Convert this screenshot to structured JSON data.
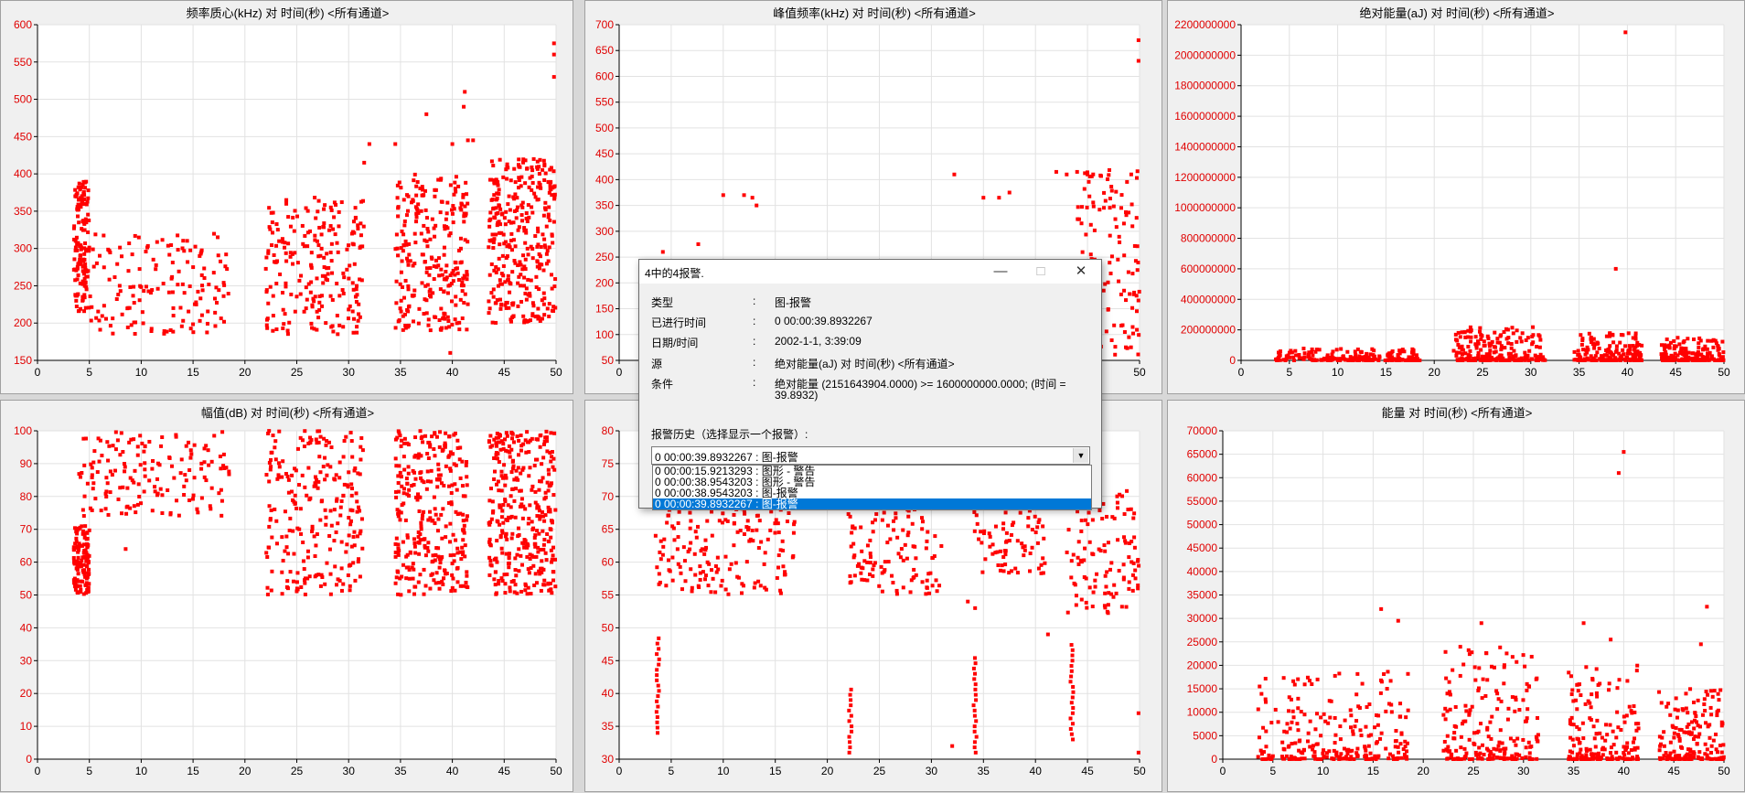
{
  "colors": {
    "point": "#ff0000",
    "axis": "#000000",
    "grid": "#e2e2e2",
    "ytick": "#e00000"
  },
  "panels": [
    {
      "title": "频率质心(kHz) 对 时间(秒) <所有通道>",
      "yticks": [
        "150",
        "200",
        "250",
        "300",
        "350",
        "400",
        "450",
        "500",
        "550",
        "600"
      ]
    },
    {
      "title": "峰值频率(kHz) 对 时间(秒) <所有通道>",
      "yticks": [
        "50",
        "100",
        "150",
        "200",
        "250",
        "300",
        "350",
        "400",
        "450",
        "500",
        "550",
        "600",
        "650",
        "700"
      ]
    },
    {
      "title": "绝对能量(aJ) 对 时间(秒) <所有通道>",
      "yticks": [
        "0",
        "200000000",
        "400000000",
        "600000000",
        "800000000",
        "1000000000",
        "1200000000",
        "1400000000",
        "1600000000",
        "1800000000",
        "2000000000",
        "2200000000"
      ]
    },
    {
      "title": "幅值(dB) 对 时间(秒) <所有通道>",
      "yticks": [
        "0",
        "10",
        "20",
        "30",
        "40",
        "50",
        "60",
        "70",
        "80",
        "90",
        "100"
      ]
    },
    {
      "title": "",
      "yticks": [
        "30",
        "35",
        "40",
        "45",
        "50",
        "55",
        "60",
        "65",
        "70",
        "75",
        "80"
      ]
    },
    {
      "title": "能量 对 时间(秒) <所有通道>",
      "yticks": [
        "0",
        "5000",
        "10000",
        "15000",
        "20000",
        "25000",
        "30000",
        "35000",
        "40000",
        "45000",
        "50000",
        "55000",
        "60000",
        "65000",
        "70000"
      ]
    }
  ],
  "xticks": [
    "0",
    "5",
    "10",
    "15",
    "20",
    "25",
    "30",
    "35",
    "40",
    "45",
    "50"
  ],
  "chart_data": [
    {
      "type": "scatter",
      "title": "频率质心(kHz) 对 时间(秒) <所有通道>",
      "xlim": [
        0,
        50
      ],
      "ylim": [
        150,
        600
      ],
      "clusters": [
        {
          "x": [
            3.5,
            5
          ],
          "y": [
            215,
            390
          ],
          "n": 140
        },
        {
          "x": [
            5,
            18.5
          ],
          "y": [
            185,
            320
          ],
          "n": 150
        },
        {
          "x": [
            22,
            31.5
          ],
          "y": [
            185,
            370
          ],
          "n": 220
        },
        {
          "x": [
            34.5,
            41.5
          ],
          "y": [
            190,
            400
          ],
          "n": 260
        },
        {
          "x": [
            43.5,
            50
          ],
          "y": [
            200,
            420
          ],
          "n": 330
        }
      ],
      "extra": [
        [
          37.5,
          480
        ],
        [
          41.2,
          510
        ],
        [
          41.1,
          490
        ],
        [
          40,
          440
        ],
        [
          41.5,
          445
        ],
        [
          42,
          445
        ],
        [
          32,
          440
        ],
        [
          31.5,
          415
        ],
        [
          34.5,
          440
        ],
        [
          39.8,
          160
        ],
        [
          49.8,
          575
        ],
        [
          49.8,
          560
        ],
        [
          49.8,
          530
        ]
      ]
    },
    {
      "type": "scatter",
      "title": "峰值频率(kHz) 对 时间(秒) <所有通道>",
      "xlim": [
        0,
        50
      ],
      "ylim": [
        50,
        700
      ],
      "extra": [
        [
          12,
          370
        ],
        [
          12.8,
          365
        ],
        [
          13.2,
          350
        ],
        [
          10,
          370
        ],
        [
          4.2,
          260
        ],
        [
          7.6,
          275
        ],
        [
          32.2,
          410
        ],
        [
          35,
          365
        ],
        [
          36.5,
          365
        ],
        [
          37.5,
          375
        ],
        [
          42,
          415
        ],
        [
          43,
          410
        ],
        [
          44,
          415
        ],
        [
          45,
          410
        ],
        [
          48.5,
          315
        ],
        [
          49.9,
          670
        ],
        [
          49.9,
          630
        ]
      ],
      "clusters": [
        {
          "x": [
            44,
            50
          ],
          "y": [
            60,
            420
          ],
          "n": 120
        }
      ]
    },
    {
      "type": "scatter",
      "title": "绝对能量(aJ) 对 时间(秒) <所有通道>",
      "xlim": [
        0,
        50
      ],
      "ylim": [
        0,
        2200000000
      ],
      "clusters": [
        {
          "x": [
            3.5,
            18.5
          ],
          "y": [
            0,
            80000000
          ],
          "n": 200
        },
        {
          "x": [
            22,
            31.5
          ],
          "y": [
            0,
            220000000
          ],
          "n": 220
        },
        {
          "x": [
            34.5,
            41.5
          ],
          "y": [
            0,
            180000000
          ],
          "n": 180
        },
        {
          "x": [
            43.5,
            50
          ],
          "y": [
            0,
            150000000
          ],
          "n": 180
        }
      ],
      "extra": [
        [
          39.8,
          2150000000
        ],
        [
          38.8,
          600000000
        ]
      ]
    },
    {
      "type": "scatter",
      "title": "幅值(dB) 对 时间(秒) <所有通道>",
      "xlim": [
        0,
        50
      ],
      "ylim": [
        0,
        100
      ],
      "clusters": [
        {
          "x": [
            3.5,
            5
          ],
          "y": [
            50,
            71
          ],
          "n": 120
        },
        {
          "x": [
            4,
            18.5
          ],
          "y": [
            74,
            100
          ],
          "n": 160
        },
        {
          "x": [
            22,
            31.5
          ],
          "y": [
            50,
            100
          ],
          "n": 240
        },
        {
          "x": [
            34.5,
            41.5
          ],
          "y": [
            50,
            100
          ],
          "n": 300
        },
        {
          "x": [
            43.5,
            50
          ],
          "y": [
            50,
            100
          ],
          "n": 340
        }
      ],
      "extra": [
        [
          8.5,
          64
        ]
      ]
    },
    {
      "type": "scatter",
      "title": "",
      "xlim": [
        0,
        50
      ],
      "ylim": [
        30,
        80
      ],
      "clusters": [
        {
          "x": [
            3.5,
            17
          ],
          "y": [
            55,
            70
          ],
          "n": 170
        },
        {
          "x": [
            22,
            31
          ],
          "y": [
            55,
            70
          ],
          "n": 120
        },
        {
          "x": [
            34,
            41
          ],
          "y": [
            58,
            70
          ],
          "n": 80
        },
        {
          "x": [
            43,
            50
          ],
          "y": [
            52,
            71
          ],
          "n": 110
        }
      ],
      "columns": [
        {
          "x": 3.7,
          "y": [
            34,
            49
          ]
        },
        {
          "x": 22.2,
          "y": [
            31,
            41
          ]
        },
        {
          "x": 34.2,
          "y": [
            31,
            46
          ]
        },
        {
          "x": 43.5,
          "y": [
            33,
            48
          ]
        }
      ],
      "extra": [
        [
          32,
          32
        ],
        [
          41.2,
          49
        ],
        [
          33.5,
          54
        ],
        [
          34.2,
          53
        ],
        [
          49.9,
          37
        ],
        [
          49.9,
          31
        ]
      ]
    },
    {
      "type": "scatter",
      "title": "能量 对 时间(秒) <所有通道>",
      "xlim": [
        0,
        50
      ],
      "ylim": [
        0,
        70000
      ],
      "clusters": [
        {
          "x": [
            3.5,
            18.5
          ],
          "y": [
            0,
            19000
          ],
          "n": 240
        },
        {
          "x": [
            22,
            31.5
          ],
          "y": [
            0,
            24000
          ],
          "n": 200
        },
        {
          "x": [
            34.5,
            41.5
          ],
          "y": [
            0,
            20000
          ],
          "n": 180
        },
        {
          "x": [
            43.5,
            50
          ],
          "y": [
            0,
            15000
          ],
          "n": 180
        }
      ],
      "extra": [
        [
          40,
          65500
        ],
        [
          39.5,
          61000
        ],
        [
          15.8,
          32000
        ],
        [
          17.5,
          29500
        ],
        [
          25.8,
          29000
        ],
        [
          36,
          29000
        ],
        [
          48.3,
          32500
        ],
        [
          47.7,
          24500
        ],
        [
          38.7,
          25500
        ]
      ]
    }
  ],
  "dialog": {
    "title": "4中的4报警.",
    "rows": [
      {
        "label": "类型",
        "colon": ":",
        "value": "图-报警"
      },
      {
        "label": "已进行时间",
        "colon": ":",
        "value": "0 00:00:39.8932267"
      },
      {
        "label": "日期/时间",
        "colon": ":",
        "value": "2002-1-1, 3:39:09"
      },
      {
        "label": "源",
        "colon": ":",
        "value": "绝对能量(aJ) 对 时间(秒) <所有通道>"
      },
      {
        "label": "条件",
        "colon": ":",
        "value": "绝对能量 (2151643904.0000) >= 1600000000.0000; (时间 ="
      },
      {
        "label": "",
        "colon": "",
        "value": "39.8932)"
      }
    ],
    "history_label": "报警历史（选择显示一个报警）:",
    "combo_value": "0 00:00:39.8932267 : 图-报警",
    "options": [
      "0 00:00:15.9213293 : 图形 - 警告",
      "0 00:00:38.9543203 : 图形 - 警告",
      "0 00:00:38.9543203 : 图-报警",
      "0 00:00:39.8932267 : 图-报警"
    ],
    "selected_index": 3,
    "minimize_icon": "minimize-icon",
    "maximize_icon": "maximize-icon",
    "close_icon": "close-icon"
  }
}
